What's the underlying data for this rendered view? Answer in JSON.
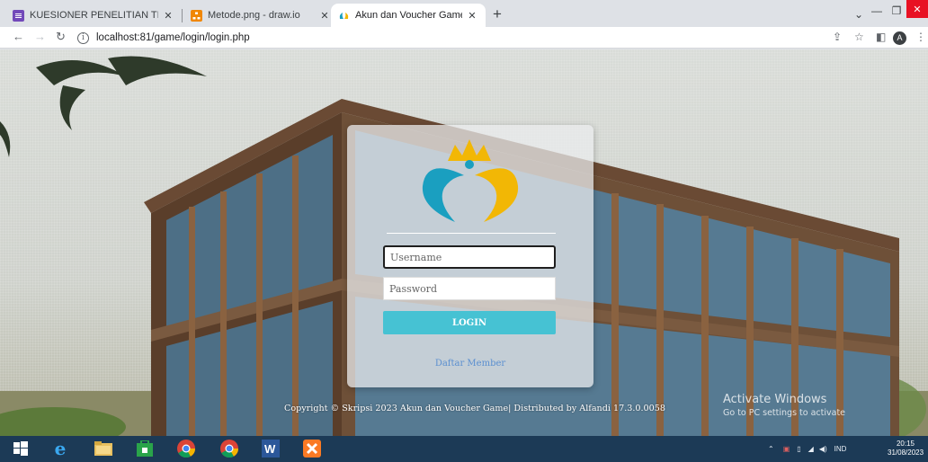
{
  "browser": {
    "tabs": [
      {
        "title": "KUESIONER PENELITIAN TINGKA",
        "favicon": "forms-icon",
        "color": "#7248b9"
      },
      {
        "title": "Metode.png - draw.io",
        "favicon": "drawio-icon",
        "color": "#f08705"
      },
      {
        "title": "Akun dan Voucher Game",
        "favicon": "game-icon",
        "color": "#1a9fc0"
      }
    ],
    "url": "localhost:81/game/login/login.php",
    "profile_initial": "A"
  },
  "login": {
    "username_placeholder": "Username",
    "password_placeholder": "Password",
    "button_label": "LOGIN",
    "register_link": "Daftar Member"
  },
  "footer": {
    "copyright": "Copyright © Skripsi 2023 Akun dan Voucher Game| Distributed by Alfandi 17.3.0.0058"
  },
  "watermark": {
    "title": "Activate Windows",
    "subtitle": "Go to PC settings to activate"
  },
  "taskbar": {
    "apps": [
      "start-icon",
      "internet-explorer-icon",
      "file-explorer-icon",
      "store-icon",
      "chrome-icon",
      "chrome-icon",
      "word-icon",
      "xampp-icon"
    ],
    "language": "IND",
    "time": "20:15",
    "date": "31/08/2023"
  },
  "colors": {
    "login_button": "#46c2d3",
    "link": "#5a8fd0",
    "taskbar": "#1c3a56"
  }
}
